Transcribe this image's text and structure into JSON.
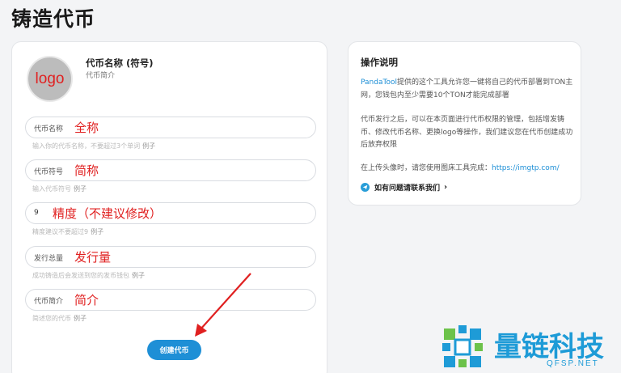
{
  "page": {
    "title": "铸造代币"
  },
  "form": {
    "avatar_text": "logo",
    "token_name": "代币名称 (符号)",
    "token_desc": "代币简介",
    "fields": [
      {
        "label": "代币名称",
        "overlay": "全称",
        "hint": "输入你的代币名称，不要超过3个单词",
        "example": "例子"
      },
      {
        "label": "代币符号",
        "overlay": "简称",
        "hint": "输入代币符号",
        "example": "例子"
      },
      {
        "value": "9",
        "overlay": "精度（不建议修改）",
        "hint": "精度建议不要超过9",
        "example": "例子"
      },
      {
        "label": "发行总量",
        "overlay": "发行量",
        "hint": "成功铸造后会发送到您的发币钱包",
        "example": "例子"
      },
      {
        "label": "代币简介",
        "overlay": "简介",
        "hint": "简述您的代币",
        "example": "例子"
      }
    ],
    "create_label": "创建代币"
  },
  "help": {
    "title": "操作说明",
    "para1_brand": "PandaTool",
    "para1_rest": "提供的这个工具允许您一键将自己的代币部署到TON主网，您钱包内至少需要10个TON才能完成部署",
    "para2": "代币发行之后，可以在本页面进行代币权限的管理，包括增发铸币、修改代币名称、更换logo等操作，我们建议您在代币创建成功后放弃权限",
    "para3_text": "在上传头像时，请您使用图床工具完成：",
    "para3_link": "https://imgtp.com/",
    "contact_label": "如有问题请联系我们"
  },
  "watermark": {
    "text": "量链科技",
    "sub": "QFSP.NET"
  },
  "colors": {
    "accent": "#1e8fd6",
    "annotation": "#e02020",
    "watermark": "#1e9bd7"
  }
}
